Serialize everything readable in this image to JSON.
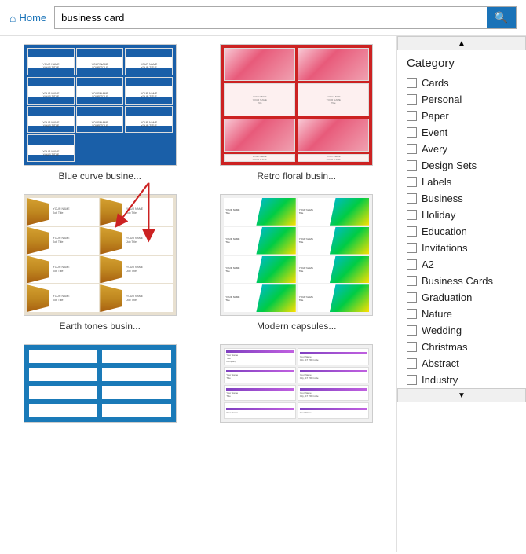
{
  "header": {
    "home_label": "Home",
    "search_value": "business card",
    "search_placeholder": "Search"
  },
  "templates": [
    {
      "id": "blue-curve",
      "label": "Blue curve busine...",
      "type": "blue_curve"
    },
    {
      "id": "retro-floral",
      "label": "Retro floral busin...",
      "type": "retro_floral"
    },
    {
      "id": "earth-tones",
      "label": "Earth tones busin...",
      "type": "earth_tones"
    },
    {
      "id": "modern-capsules",
      "label": "Modern capsules...",
      "type": "modern_capsules"
    },
    {
      "id": "blue-partial",
      "label": "",
      "type": "blue_partial"
    },
    {
      "id": "purple-partial",
      "label": "",
      "type": "purple_partial"
    }
  ],
  "sidebar": {
    "category_header": "Category",
    "items": [
      {
        "label": "Cards",
        "checked": true
      },
      {
        "label": "Personal",
        "checked": false
      },
      {
        "label": "Paper",
        "checked": false
      },
      {
        "label": "Event",
        "checked": false
      },
      {
        "label": "Avery",
        "checked": false
      },
      {
        "label": "Design Sets",
        "checked": false
      },
      {
        "label": "Labels",
        "checked": false
      },
      {
        "label": "Business",
        "checked": false
      },
      {
        "label": "Holiday",
        "checked": false
      },
      {
        "label": "Education",
        "checked": false
      },
      {
        "label": "Invitations",
        "checked": false
      },
      {
        "label": "A2",
        "checked": false
      },
      {
        "label": "Business Cards",
        "checked": false
      },
      {
        "label": "Graduation",
        "checked": false
      },
      {
        "label": "Nature",
        "checked": false
      },
      {
        "label": "Wedding",
        "checked": false
      },
      {
        "label": "Christmas",
        "checked": false
      },
      {
        "label": "Abstract",
        "checked": false
      },
      {
        "label": "Industry",
        "checked": false
      }
    ]
  },
  "icons": {
    "home": "⌂",
    "search": "🔍",
    "scroll_up": "▲",
    "scroll_down": "▼"
  }
}
